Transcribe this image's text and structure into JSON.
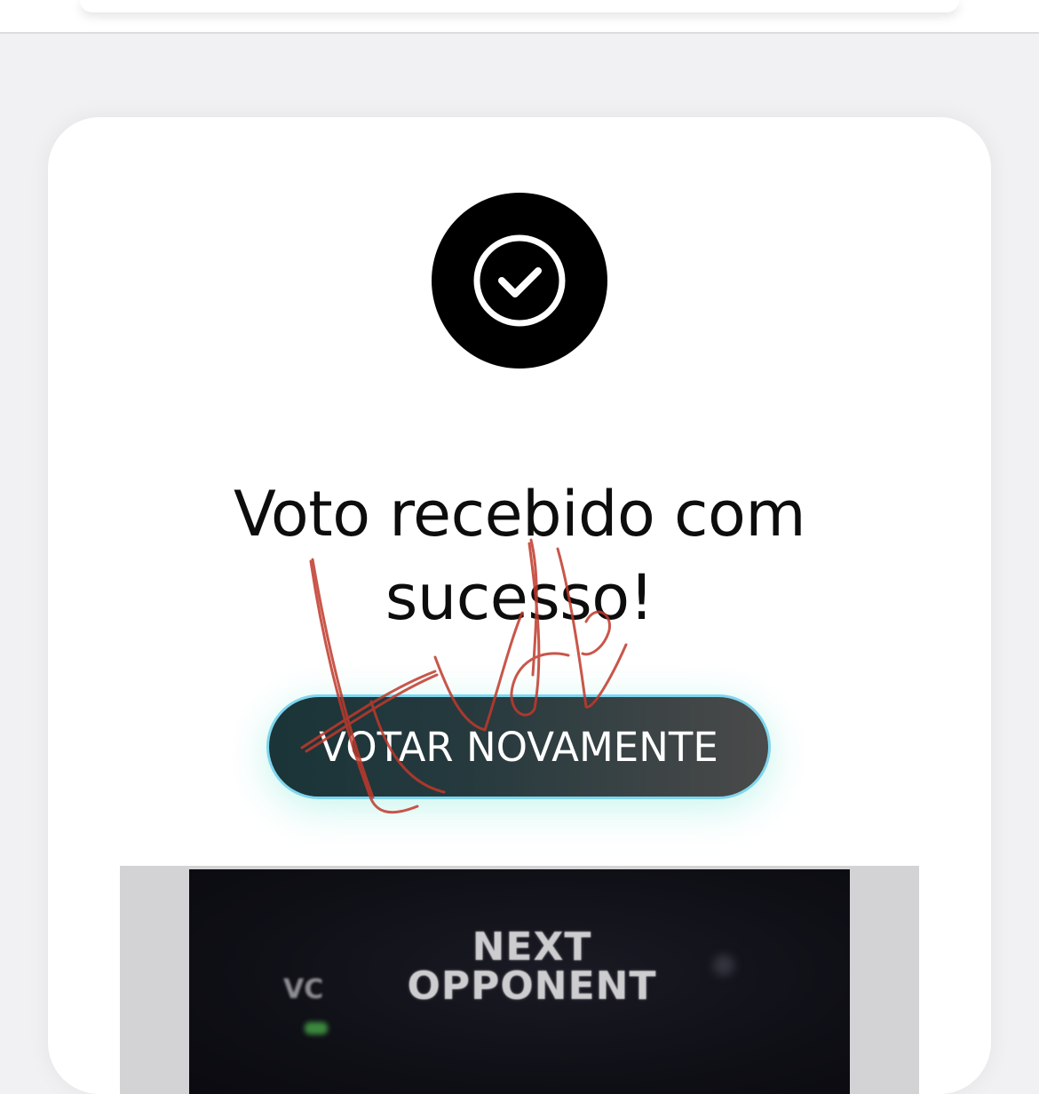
{
  "confirmation": {
    "icon": "check-circle-icon",
    "title": "Voto recebido com sucesso!",
    "vote_again_label": "VOTAR NOVAMENTE"
  },
  "promo": {
    "line1": "NEXT",
    "line2": "OPPONENT",
    "side_text": "VC"
  },
  "colors": {
    "page_bg": "#f1f1f4",
    "card_bg": "#ffffff",
    "badge_bg": "#000000",
    "button_start": "#1a3438",
    "button_end": "#4a4a4a",
    "button_border": "#7fd6ee",
    "button_glow": "#82e8d6",
    "ink": "#c0392b"
  }
}
